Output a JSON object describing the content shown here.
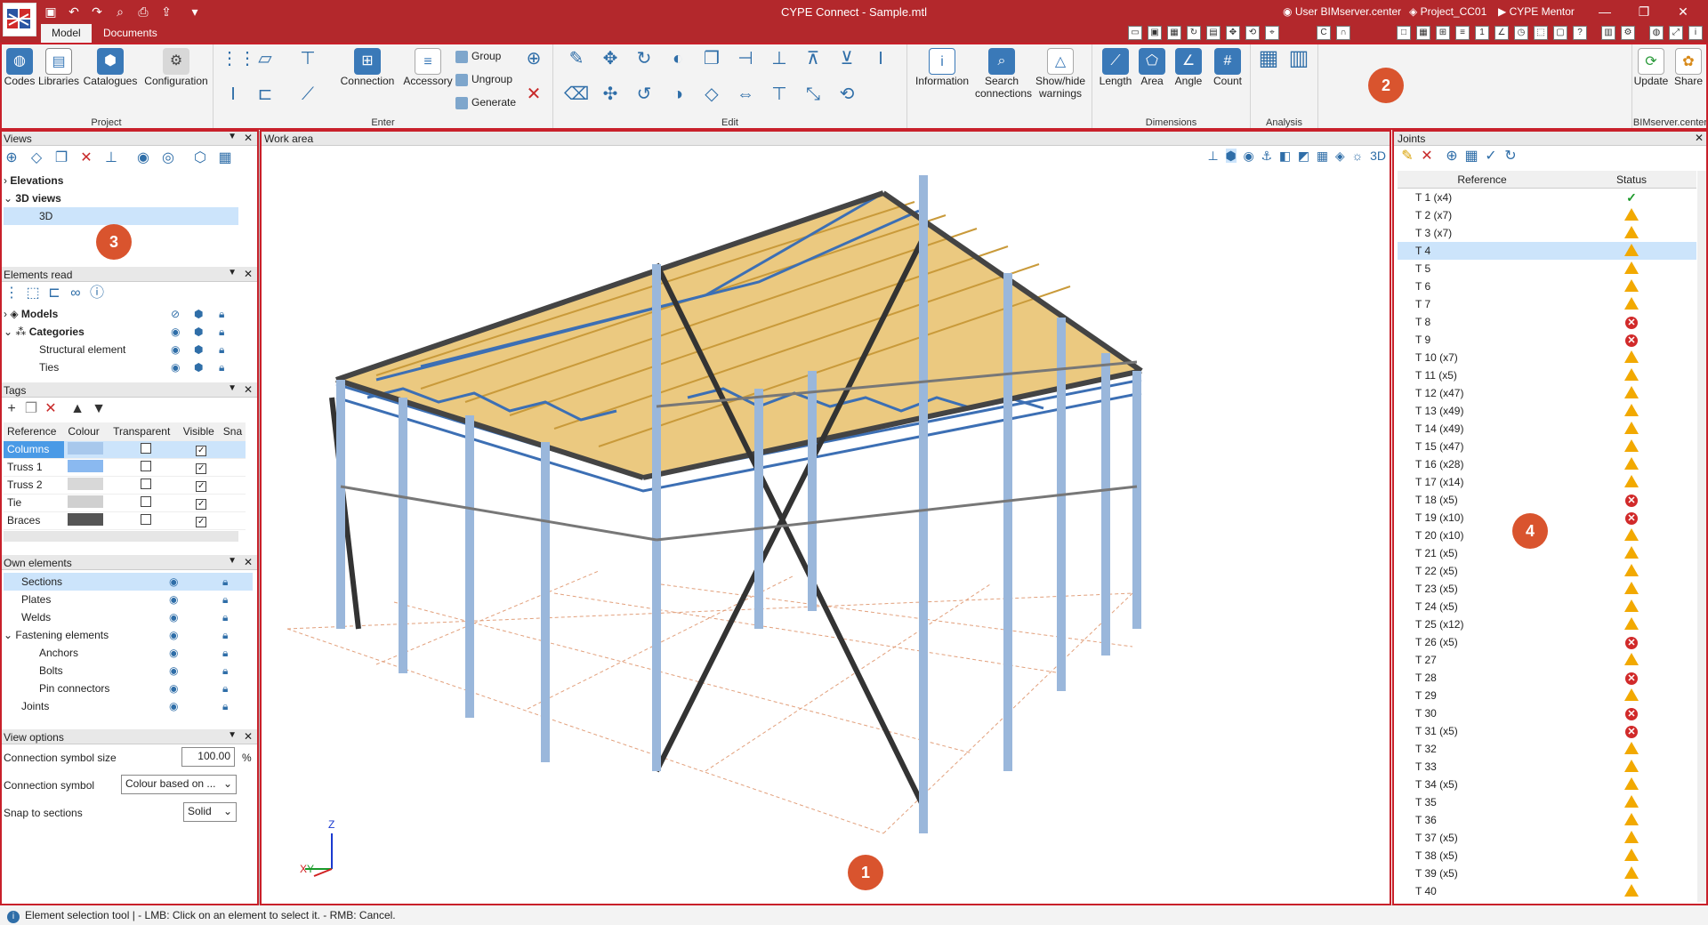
{
  "app": {
    "window_title": "CYPE Connect - Sample.mtl",
    "user": "User BIMserver.center",
    "project": "Project_CC01",
    "mentor": "CYPE Mentor"
  },
  "tabs": [
    "Model",
    "Documents"
  ],
  "ribbon": {
    "groups": [
      {
        "label": "Project",
        "buttons": [
          "Codes",
          "Libraries",
          "Catalogues",
          "Configuration"
        ]
      },
      {
        "label": "Enter",
        "buttons": [
          "Connection",
          "Accessory"
        ],
        "small": [
          "Group",
          "Ungroup",
          "Generate"
        ]
      },
      {
        "label": "Edit"
      },
      {
        "label": "",
        "buttons": [
          "Information",
          "Search connections",
          "Show/hide warnings"
        ]
      },
      {
        "label": "Dimensions",
        "buttons": [
          "Length",
          "Area",
          "Angle",
          "Count"
        ]
      },
      {
        "label": "Analysis"
      },
      {
        "label": "BIMserver.center",
        "buttons": [
          "Update",
          "Share"
        ]
      }
    ]
  },
  "views_panel": {
    "title": "Views",
    "items": [
      "Elevations",
      "3D views",
      "3D"
    ]
  },
  "elements_read": {
    "title": "Elements read",
    "items": [
      "Models",
      "Categories",
      "Structural element",
      "Ties"
    ]
  },
  "tags": {
    "title": "Tags",
    "headers": [
      "Reference",
      "Colour",
      "Transparent",
      "Visible",
      "Sna"
    ],
    "rows": [
      {
        "ref": "Columns",
        "colour": "#a8c8ec"
      },
      {
        "ref": "Truss 1",
        "colour": "#8ab9f0"
      },
      {
        "ref": "Truss 2",
        "colour": "#d8d8d8"
      },
      {
        "ref": "Tie",
        "colour": "#d0d0d0"
      },
      {
        "ref": "Braces",
        "colour": "#555555"
      }
    ]
  },
  "own_elements": {
    "title": "Own elements",
    "items": [
      "Sections",
      "Plates",
      "Welds",
      "Fastening elements",
      "Anchors",
      "Bolts",
      "Pin connectors",
      "Joints"
    ]
  },
  "view_options": {
    "title": "View options",
    "size_label": "Connection symbol size",
    "size_value": "100.00",
    "size_unit": "%",
    "symbol_label": "Connection symbol",
    "symbol_value": "Colour based on ...",
    "snap_label": "Snap to sections",
    "snap_value": "Solid"
  },
  "work_area": {
    "title": "Work area",
    "axes": {
      "z": "Z",
      "x": "X",
      "y": "Y"
    }
  },
  "joints": {
    "title": "Joints",
    "headers": [
      "Reference",
      "Status"
    ],
    "rows": [
      {
        "ref": "T 1 (x4)",
        "status": "ok"
      },
      {
        "ref": "T 2 (x7)",
        "status": "warn"
      },
      {
        "ref": "T 3 (x7)",
        "status": "warn"
      },
      {
        "ref": "T 4",
        "status": "warn"
      },
      {
        "ref": "T 5",
        "status": "warn"
      },
      {
        "ref": "T 6",
        "status": "warn"
      },
      {
        "ref": "T 7",
        "status": "warn"
      },
      {
        "ref": "T 8",
        "status": "err"
      },
      {
        "ref": "T 9",
        "status": "err"
      },
      {
        "ref": "T 10 (x7)",
        "status": "warn"
      },
      {
        "ref": "T 11 (x5)",
        "status": "warn"
      },
      {
        "ref": "T 12 (x47)",
        "status": "warn"
      },
      {
        "ref": "T 13 (x49)",
        "status": "warn"
      },
      {
        "ref": "T 14 (x49)",
        "status": "warn"
      },
      {
        "ref": "T 15 (x47)",
        "status": "warn"
      },
      {
        "ref": "T 16 (x28)",
        "status": "warn"
      },
      {
        "ref": "T 17 (x14)",
        "status": "warn"
      },
      {
        "ref": "T 18 (x5)",
        "status": "err"
      },
      {
        "ref": "T 19 (x10)",
        "status": "err"
      },
      {
        "ref": "T 20 (x10)",
        "status": "warn"
      },
      {
        "ref": "T 21 (x5)",
        "status": "warn"
      },
      {
        "ref": "T 22 (x5)",
        "status": "warn"
      },
      {
        "ref": "T 23 (x5)",
        "status": "warn"
      },
      {
        "ref": "T 24 (x5)",
        "status": "warn"
      },
      {
        "ref": "T 25 (x12)",
        "status": "warn"
      },
      {
        "ref": "T 26 (x5)",
        "status": "err"
      },
      {
        "ref": "T 27",
        "status": "warn"
      },
      {
        "ref": "T 28",
        "status": "err"
      },
      {
        "ref": "T 29",
        "status": "warn"
      },
      {
        "ref": "T 30",
        "status": "err"
      },
      {
        "ref": "T 31 (x5)",
        "status": "err"
      },
      {
        "ref": "T 32",
        "status": "warn"
      },
      {
        "ref": "T 33",
        "status": "warn"
      },
      {
        "ref": "T 34 (x5)",
        "status": "warn"
      },
      {
        "ref": "T 35",
        "status": "warn"
      },
      {
        "ref": "T 36",
        "status": "warn"
      },
      {
        "ref": "T 37 (x5)",
        "status": "warn"
      },
      {
        "ref": "T 38 (x5)",
        "status": "warn"
      },
      {
        "ref": "T 39 (x5)",
        "status": "warn"
      },
      {
        "ref": "T 40",
        "status": "warn"
      }
    ]
  },
  "markers": [
    "1",
    "2",
    "3",
    "4"
  ],
  "status_bar": "Element selection tool  |  - LMB: Click on an element to select it. - RMB: Cancel.",
  "colors": {
    "titlebar": "#b3282c",
    "marker": "#d9542e",
    "highlight": "#c8202a",
    "selection": "#cce4fb"
  }
}
